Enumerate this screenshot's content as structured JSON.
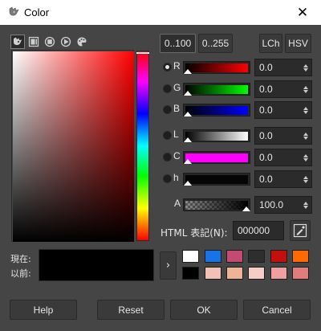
{
  "window": {
    "title": "Color",
    "app_icon": "gimp-wilber-icon",
    "close_glyph": "✕"
  },
  "selector_tabs": [
    {
      "icon": "color-scales-icon",
      "active": true
    },
    {
      "icon": "color-square-icon",
      "active": false
    },
    {
      "icon": "color-wheel-icon",
      "active": false
    },
    {
      "icon": "color-triangle-icon",
      "active": false
    },
    {
      "icon": "palette-icon",
      "active": false
    }
  ],
  "range_buttons": [
    "0..100",
    "0..255"
  ],
  "model_buttons": [
    "LCh",
    "HSV"
  ],
  "channels": [
    {
      "label": "R",
      "value": "0.0",
      "selected": true
    },
    {
      "label": "G",
      "value": "0.0",
      "selected": false
    },
    {
      "label": "B",
      "value": "0.0",
      "selected": false
    },
    {
      "label": "L",
      "value": "0.0",
      "selected": false
    },
    {
      "label": "C",
      "value": "0.0",
      "selected": false
    },
    {
      "label": "h",
      "value": "0.0",
      "selected": false
    },
    {
      "label": "A",
      "value": "100.0",
      "selected": false
    }
  ],
  "html_notation": {
    "label": "HTML 表記(N):",
    "value": "000000"
  },
  "preview": {
    "current_label": "現在:",
    "old_label": "以前:",
    "current_color": "#000000",
    "old_color": "#000000"
  },
  "history": {
    "arrow": "›",
    "swatches": [
      "#ffffff",
      "#1773e6",
      "#c24a73",
      "#2e2e2e",
      "#c40f0f",
      "#ff6a00",
      "#000000",
      "#f2c1b6",
      "#efb495",
      "#f4cec6",
      "#ef9f9f",
      "#e07c7c"
    ]
  },
  "actions": {
    "help": "Help",
    "reset": "Reset",
    "ok": "OK",
    "cancel": "Cancel"
  }
}
